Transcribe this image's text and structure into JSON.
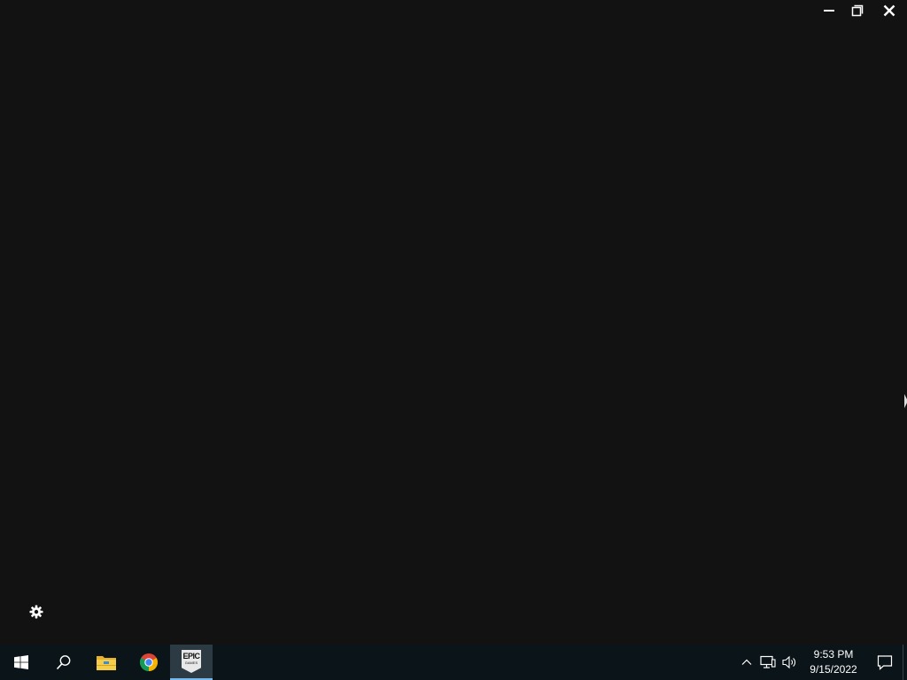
{
  "window": {
    "controls": {
      "minimize_icon": "minimize-icon",
      "restore_icon": "restore-icon",
      "close_icon": "close-icon"
    },
    "settings_icon": "gear-icon",
    "background_color": "#121212"
  },
  "taskbar": {
    "background_color": "#0b1418",
    "active_indicator_color": "#76b9ed",
    "buttons": [
      {
        "icon": "windows-start-icon"
      },
      {
        "icon": "search-icon"
      },
      {
        "icon": "file-explorer-icon"
      },
      {
        "icon": "chrome-icon"
      },
      {
        "icon": "epic-games-launcher-icon",
        "logo_text": "EPIC",
        "logo_subtext": "GAMES",
        "active": true
      }
    ],
    "tray": {
      "icons": [
        "chevron-up-icon",
        "network-icon",
        "volume-icon"
      ],
      "time": "9:53 PM",
      "date": "9/15/2022",
      "notification_icon": "action-center-icon"
    }
  }
}
